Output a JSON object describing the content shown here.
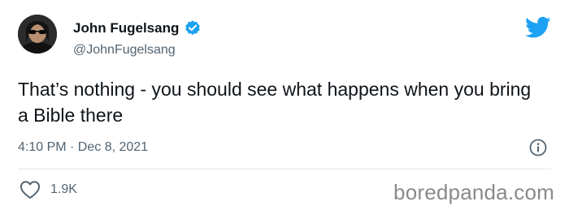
{
  "author": {
    "display_name": "John Fugelsang",
    "handle": "@JohnFugelsang",
    "verified": true
  },
  "tweet": {
    "text": "That’s nothing - you should see what happens when you bring a Bible there",
    "timestamp": "4:10 PM · Dec 8, 2021"
  },
  "engagement": {
    "like_count": "1.9K"
  },
  "watermark": {
    "text": "boredpanda.com"
  },
  "icons": {
    "verified": "verified-badge-icon",
    "brand": "twitter-bird-icon",
    "info": "info-icon",
    "like": "heart-icon"
  },
  "colors": {
    "brand": "#1da1f2",
    "text_primary": "#0f1419",
    "text_secondary": "#536471"
  }
}
